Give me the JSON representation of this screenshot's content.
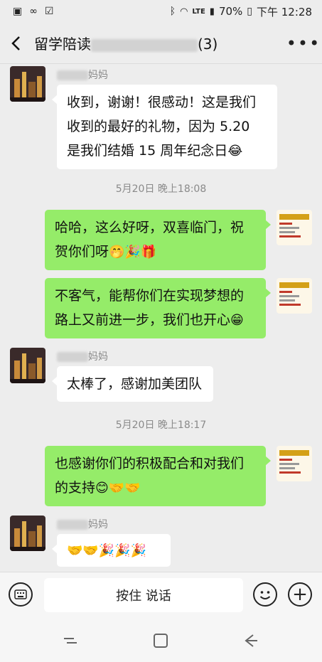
{
  "status": {
    "battery": "70%",
    "time": "下午 12:28",
    "network": "LTE"
  },
  "header": {
    "title_prefix": "留学陪读",
    "title_suffix": "(3)"
  },
  "messages": [
    {
      "type": "in",
      "nick_suffix": "妈妈",
      "text": "收到，谢谢！很感动！这是我们收到的最好的礼物，因为 5.20 是我们结婚 15 周年纪念日",
      "emoji": "😂"
    },
    {
      "type": "time",
      "text": "5月20日 晚上18:08"
    },
    {
      "type": "out",
      "text": "哈哈，这么好呀，双喜临门，祝贺你们呀",
      "emoji": "🤭🎉🎁"
    },
    {
      "type": "out",
      "text": "不客气，能帮你们在实现梦想的路上又前进一步，我们也开心",
      "emoji": "😁"
    },
    {
      "type": "in",
      "nick_suffix": "妈妈",
      "text": "太棒了，感谢加美团队",
      "emoji": ""
    },
    {
      "type": "time",
      "text": "5月20日 晚上18:17"
    },
    {
      "type": "out",
      "text": "也感谢你们的积极配合和对我们的支持",
      "emoji": "😊🤝🤝"
    },
    {
      "type": "in",
      "nick_suffix": "妈妈",
      "text": "",
      "emoji": "🤝🤝🎉🎉🎉"
    }
  ],
  "input": {
    "talk_label": "按住 说话"
  },
  "icons": {
    "back": "back-arrow-icon",
    "more": "more-dots-icon",
    "keyboard": "keyboard-icon",
    "emoji": "emoji-icon",
    "plus": "plus-icon"
  },
  "colors": {
    "outgoing": "#95ec69",
    "incoming": "#ffffff",
    "background": "#ededed"
  }
}
